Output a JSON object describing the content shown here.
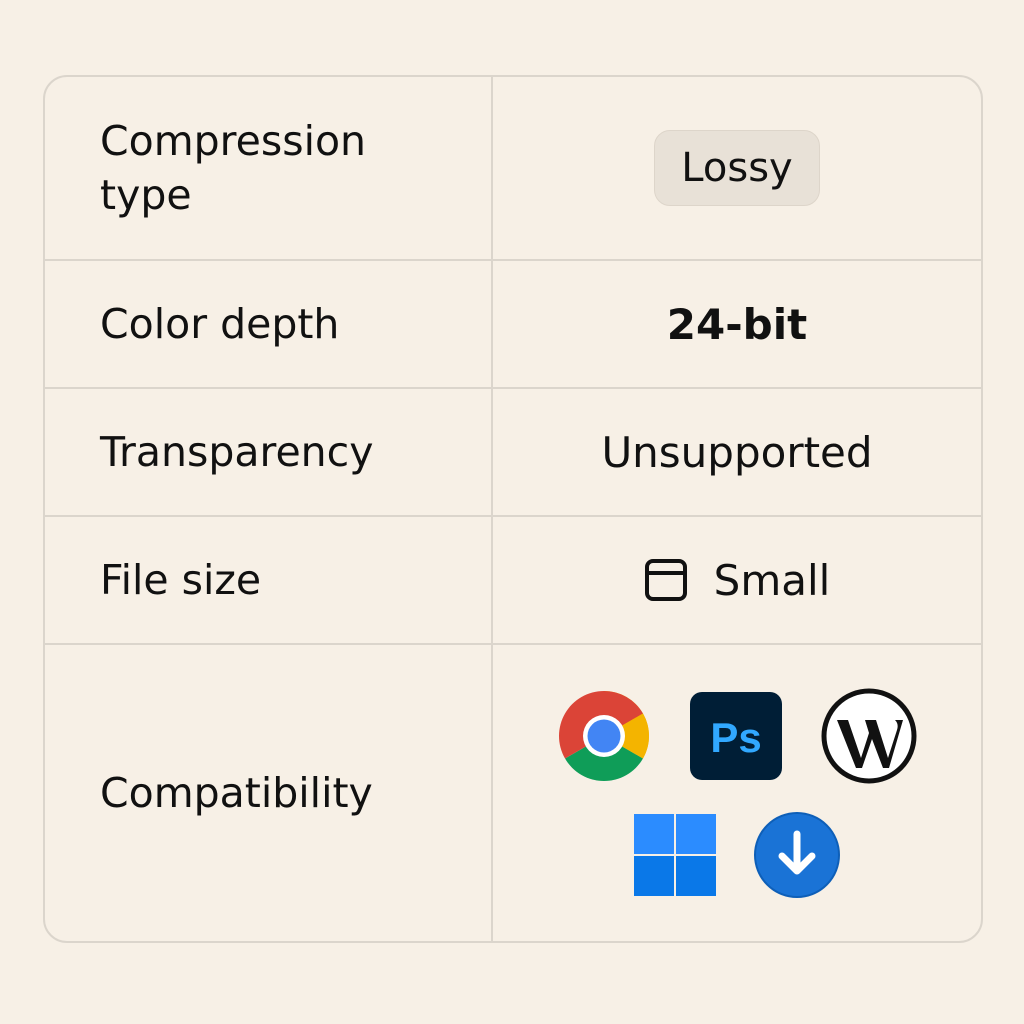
{
  "rows": [
    {
      "label": "Compression type",
      "value": "Lossy"
    },
    {
      "label": "Color depth",
      "value": "24-bit"
    },
    {
      "label": "Transparency",
      "value": "Unsupported"
    },
    {
      "label": "File size",
      "value": "Small",
      "icon": "window-icon"
    },
    {
      "label": "Compatibility",
      "icons": [
        "chrome-icon",
        "photoshop-icon",
        "wordpress-icon",
        "windows-icon",
        "download-icon"
      ]
    }
  ],
  "photoshop_text": "Ps",
  "colors": {
    "background": "#f7f0e6",
    "border": "#dbd5cc",
    "badge": "#e8e1d7",
    "chrome_red": "#db4437",
    "chrome_green": "#0f9d58",
    "chrome_yellow": "#f4b400",
    "chrome_blue": "#4285f4",
    "photoshop_bg": "#001e36",
    "photoshop_text": "#31a8ff",
    "windows_blue": "#0a78e8",
    "download_blue": "#1a73d6"
  }
}
